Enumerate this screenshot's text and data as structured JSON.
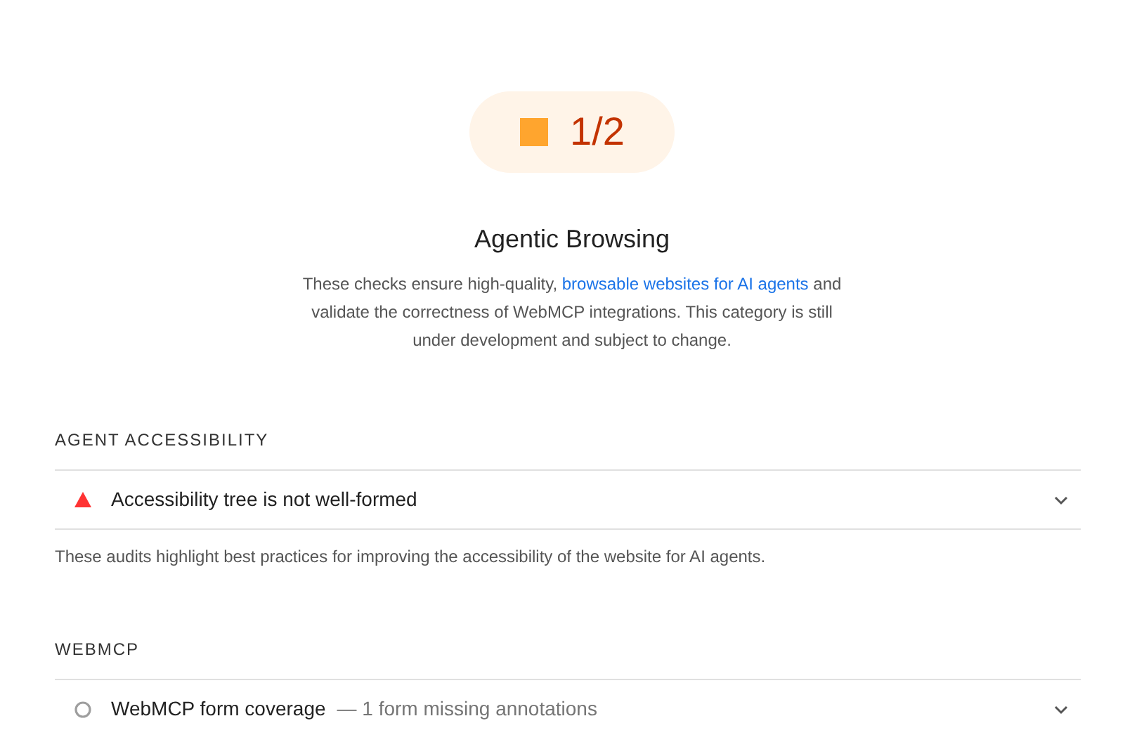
{
  "score": {
    "kind": "average",
    "value": "1/2"
  },
  "category": {
    "title": "Agentic Browsing",
    "description_before": "These checks ensure high-quality, ",
    "description_link": "browsable websites for AI agents",
    "description_after": " and validate the correctness of WebMCP integrations. This category is still under development and subject to change."
  },
  "sections": [
    {
      "title": "AGENT ACCESSIBILITY",
      "audits": [
        {
          "kind": "fail",
          "title": "Accessibility tree is not well-formed",
          "expanded": false
        }
      ],
      "description": "These audits highlight best practices for improving the accessibility of the website for AI agents."
    },
    {
      "title": "WEBMCP",
      "audits": [
        {
          "kind": "informative",
          "title": "WebMCP form coverage",
          "summary": "— 1 form missing annotations",
          "expanded": false
        }
      ]
    }
  ]
}
